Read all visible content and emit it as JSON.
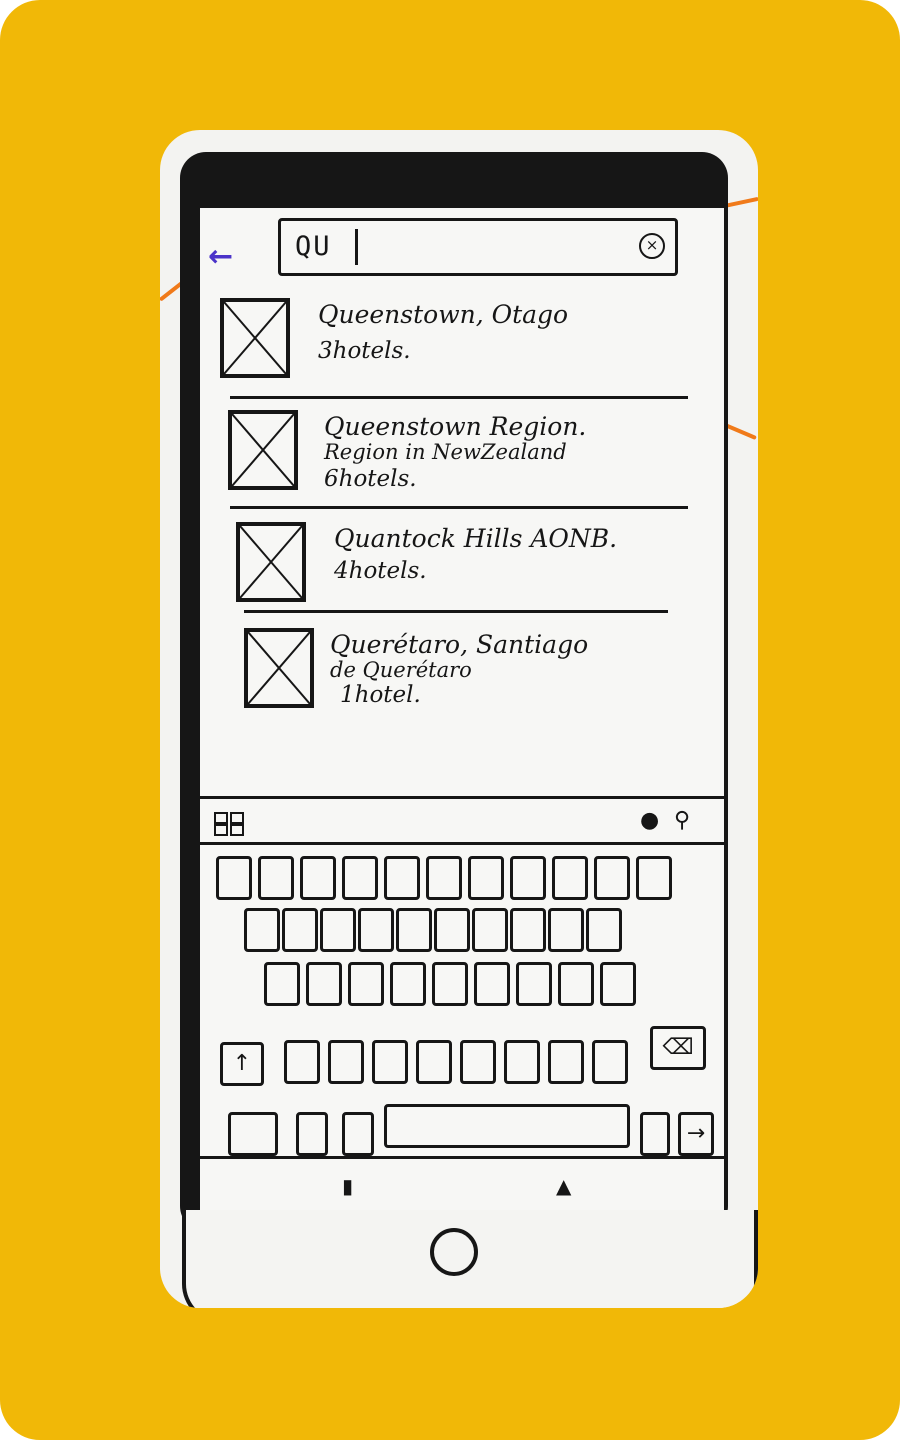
{
  "search": {
    "value": "QU",
    "back_icon": "arrow-left-icon",
    "clear_icon": "close-circle-icon"
  },
  "results": [
    {
      "title": "Queenstown, Otago",
      "subtitle": "",
      "count": "3hotels."
    },
    {
      "title": "Queenstown Region.",
      "subtitle": "Region in NewZealand",
      "count": "6hotels."
    },
    {
      "title": "Quantock Hills AONB.",
      "subtitle": "",
      "count": "4hotels."
    },
    {
      "title": "Querétaro, Santiago",
      "subtitle": "de Querétaro",
      "count": "1hotel."
    }
  ],
  "keyboard": {
    "tools": [
      "apps-icon",
      "mic-icon",
      "search-icon"
    ],
    "shift_icon": "arrow-up-icon",
    "backspace_icon": "backspace-icon",
    "enter_icon": "enter-icon"
  },
  "colors": {
    "frame": "#F1B807",
    "ink": "#161616",
    "annotation_orange": "#F07A1A",
    "annotation_purple": "#4B33C9"
  }
}
